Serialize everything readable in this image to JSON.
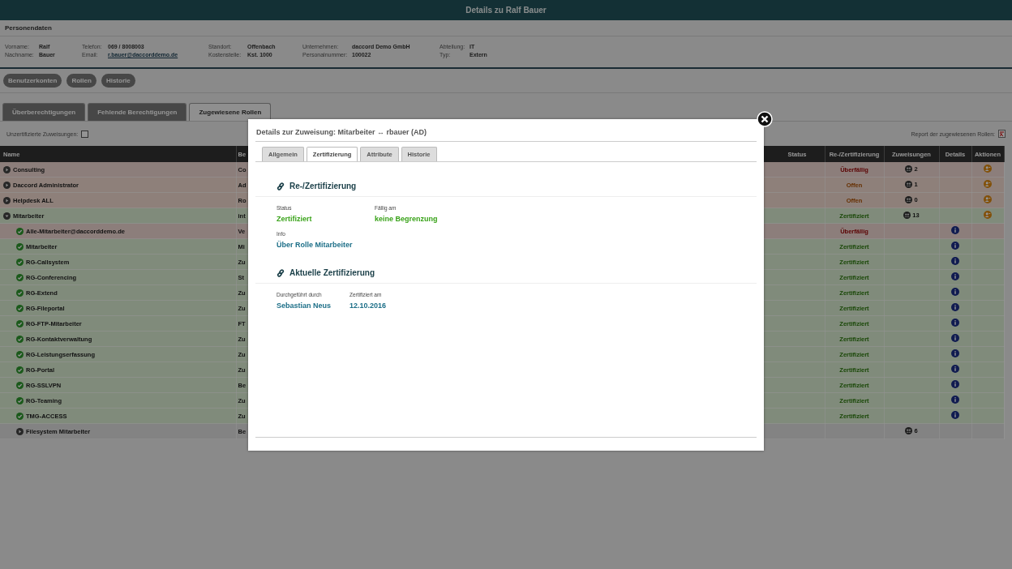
{
  "window": {
    "title": "Details zu Ralf Bauer"
  },
  "person": {
    "title": "Personendaten",
    "groups": [
      [
        {
          "label": "Vorname:",
          "value": "Ralf"
        },
        {
          "label": "Nachname:",
          "value": "Bauer"
        }
      ],
      [
        {
          "label": "Telefon:",
          "value": "069 / 8008003"
        },
        {
          "label": "Email:",
          "value": "r.bauer@daccorddemo.de",
          "kind": "link"
        }
      ],
      [
        {
          "label": "Standort:",
          "value": "Offenbach"
        },
        {
          "label": "Kostenstelle:",
          "value": "Kst. 1000"
        }
      ],
      [
        {
          "label": "Unternehmen:",
          "value": "daccord Demo GmbH"
        },
        {
          "label": "Personalnummer:",
          "value": "100022"
        }
      ],
      [
        {
          "label": "Abteilung:",
          "value": "IT"
        },
        {
          "label": "Typ:",
          "value": "Extern"
        }
      ]
    ]
  },
  "nav_buttons": [
    "Benutzerkonten",
    "Rollen",
    "Historie"
  ],
  "tabs": [
    {
      "label": "Überberechtigungen",
      "selected": false
    },
    {
      "label": "Fehlende Berechtigungen",
      "selected": false
    },
    {
      "label": "Zugewiesene Rollen",
      "selected": true
    }
  ],
  "filter": {
    "label": "Unzertifizierte Zuweisungen:",
    "checked": false
  },
  "report": {
    "label": "Report der zugewiesenen Rollen:"
  },
  "table": {
    "columns": [
      "Name",
      "Be",
      "Status",
      "Re-/Zertifizierung",
      "Zuweisungen",
      "Details",
      "Aktionen"
    ],
    "rows": [
      {
        "name": "Consulting",
        "expanded": false,
        "column_2": "Co",
        "kind": "overdue",
        "recert": "Überfällig",
        "assignments": "2",
        "details": false,
        "actions": true
      },
      {
        "name": "Daccord Administrator",
        "expanded": false,
        "column_2": "Ad",
        "kind": "open",
        "recert": "Offen",
        "assignments": "1",
        "details": false,
        "actions": true
      },
      {
        "name": "Helpdesk ALL",
        "expanded": false,
        "column_2": "Ro",
        "kind": "open",
        "recert": "Offen",
        "assignments": "0",
        "details": false,
        "actions": true
      },
      {
        "name": "Mitarbeiter",
        "expanded": true,
        "column_2": "int",
        "kind": "certified",
        "recert": "Zertifiziert",
        "assignments": "13",
        "details": false,
        "actions": true,
        "children": [
          {
            "name": "Alle-Mitarbeiter@daccorddemo.de",
            "column_2": "Ve",
            "kind": "overdue",
            "recert": "Überfällig",
            "details": true,
            "actions": false
          },
          {
            "name": "Mitarbeiter",
            "column_2": "Mi",
            "kind": "certified",
            "recert": "Zertifiziert",
            "details": true,
            "actions": false
          },
          {
            "name": "RG-Callsystem",
            "column_2": "Zu",
            "kind": "certified",
            "recert": "Zertifiziert",
            "details": true,
            "actions": false
          },
          {
            "name": "RG-Conferencing",
            "column_2": "St",
            "kind": "certified",
            "recert": "Zertifiziert",
            "details": true,
            "actions": false
          },
          {
            "name": "RG-Extend",
            "column_2": "Zu",
            "kind": "certified",
            "recert": "Zertifiziert",
            "details": true,
            "actions": false
          },
          {
            "name": "RG-Fileportal",
            "column_2": "Zu",
            "kind": "certified",
            "recert": "Zertifiziert",
            "details": true,
            "actions": false
          },
          {
            "name": "RG-FTP-Mitarbeiter",
            "column_2": "FT",
            "kind": "certified",
            "recert": "Zertifiziert",
            "details": true,
            "actions": false
          },
          {
            "name": "RG-Kontaktverwaltung",
            "column_2": "Zu",
            "kind": "certified",
            "recert": "Zertifiziert",
            "details": true,
            "actions": false
          },
          {
            "name": "RG-Leistungserfassung",
            "column_2": "Zu",
            "kind": "certified",
            "recert": "Zertifiziert",
            "details": true,
            "actions": false
          },
          {
            "name": "RG-Portal",
            "column_2": "Zu",
            "kind": "certified",
            "recert": "Zertifiziert",
            "details": true,
            "actions": false
          },
          {
            "name": "RG-SSLVPN",
            "column_2": "Be",
            "kind": "certified",
            "recert": "Zertifiziert",
            "details": true,
            "actions": false
          },
          {
            "name": "RG-Teaming",
            "column_2": "Zu",
            "kind": "certified",
            "recert": "Zertifiziert",
            "details": true,
            "actions": false
          },
          {
            "name": "TMG-ACCESS",
            "column_2": "Zu",
            "kind": "certified",
            "recert": "Zertifiziert",
            "details": true,
            "actions": false
          },
          {
            "name": "Filesystem Mitarbeiter",
            "expanded": false,
            "column_2": "Be",
            "kind": "plain",
            "assignments": "6",
            "details": false,
            "actions": false
          }
        ]
      }
    ]
  },
  "dialog": {
    "title": "Details zur Zuweisung: Mitarbeiter ↔ rbauer (AD)",
    "tabs": [
      {
        "label": "Allgemein",
        "selected": false
      },
      {
        "label": "Zertifizierung",
        "selected": true
      },
      {
        "label": "Attribute",
        "selected": false
      },
      {
        "label": "Historie",
        "selected": false
      }
    ],
    "sections": [
      {
        "title": "Re-/Zertifizierung",
        "rows": [
          [
            {
              "label": "Status",
              "value": "Zertifiziert",
              "kind": "success"
            },
            {
              "label": "Fällig am",
              "value": "keine Begrenzung",
              "kind": "success"
            }
          ],
          [
            {
              "label": "Info",
              "value": "Über Rolle Mitarbeiter",
              "kind": "info"
            }
          ]
        ]
      },
      {
        "title": "Aktuelle Zertifizierung",
        "rows": [
          [
            {
              "label": "Durchgeführt durch",
              "value": "Sebastian Neus",
              "kind": "info"
            },
            {
              "label": "Zertifiziert am",
              "value": "12.10.2016",
              "kind": "info"
            }
          ]
        ]
      }
    ]
  }
}
